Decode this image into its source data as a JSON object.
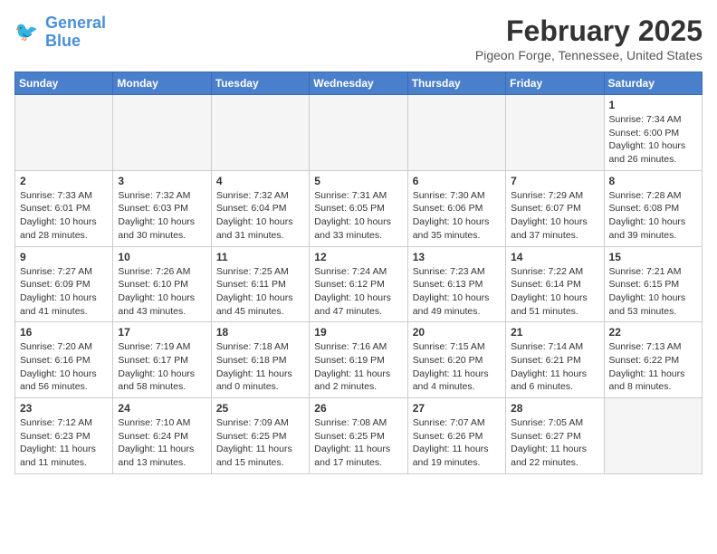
{
  "header": {
    "logo_line1": "General",
    "logo_line2": "Blue",
    "title": "February 2025",
    "subtitle": "Pigeon Forge, Tennessee, United States"
  },
  "weekdays": [
    "Sunday",
    "Monday",
    "Tuesday",
    "Wednesday",
    "Thursday",
    "Friday",
    "Saturday"
  ],
  "weeks": [
    [
      {
        "day": "",
        "info": ""
      },
      {
        "day": "",
        "info": ""
      },
      {
        "day": "",
        "info": ""
      },
      {
        "day": "",
        "info": ""
      },
      {
        "day": "",
        "info": ""
      },
      {
        "day": "",
        "info": ""
      },
      {
        "day": "1",
        "info": "Sunrise: 7:34 AM\nSunset: 6:00 PM\nDaylight: 10 hours and 26 minutes."
      }
    ],
    [
      {
        "day": "2",
        "info": "Sunrise: 7:33 AM\nSunset: 6:01 PM\nDaylight: 10 hours and 28 minutes."
      },
      {
        "day": "3",
        "info": "Sunrise: 7:32 AM\nSunset: 6:03 PM\nDaylight: 10 hours and 30 minutes."
      },
      {
        "day": "4",
        "info": "Sunrise: 7:32 AM\nSunset: 6:04 PM\nDaylight: 10 hours and 31 minutes."
      },
      {
        "day": "5",
        "info": "Sunrise: 7:31 AM\nSunset: 6:05 PM\nDaylight: 10 hours and 33 minutes."
      },
      {
        "day": "6",
        "info": "Sunrise: 7:30 AM\nSunset: 6:06 PM\nDaylight: 10 hours and 35 minutes."
      },
      {
        "day": "7",
        "info": "Sunrise: 7:29 AM\nSunset: 6:07 PM\nDaylight: 10 hours and 37 minutes."
      },
      {
        "day": "8",
        "info": "Sunrise: 7:28 AM\nSunset: 6:08 PM\nDaylight: 10 hours and 39 minutes."
      }
    ],
    [
      {
        "day": "9",
        "info": "Sunrise: 7:27 AM\nSunset: 6:09 PM\nDaylight: 10 hours and 41 minutes."
      },
      {
        "day": "10",
        "info": "Sunrise: 7:26 AM\nSunset: 6:10 PM\nDaylight: 10 hours and 43 minutes."
      },
      {
        "day": "11",
        "info": "Sunrise: 7:25 AM\nSunset: 6:11 PM\nDaylight: 10 hours and 45 minutes."
      },
      {
        "day": "12",
        "info": "Sunrise: 7:24 AM\nSunset: 6:12 PM\nDaylight: 10 hours and 47 minutes."
      },
      {
        "day": "13",
        "info": "Sunrise: 7:23 AM\nSunset: 6:13 PM\nDaylight: 10 hours and 49 minutes."
      },
      {
        "day": "14",
        "info": "Sunrise: 7:22 AM\nSunset: 6:14 PM\nDaylight: 10 hours and 51 minutes."
      },
      {
        "day": "15",
        "info": "Sunrise: 7:21 AM\nSunset: 6:15 PM\nDaylight: 10 hours and 53 minutes."
      }
    ],
    [
      {
        "day": "16",
        "info": "Sunrise: 7:20 AM\nSunset: 6:16 PM\nDaylight: 10 hours and 56 minutes."
      },
      {
        "day": "17",
        "info": "Sunrise: 7:19 AM\nSunset: 6:17 PM\nDaylight: 10 hours and 58 minutes."
      },
      {
        "day": "18",
        "info": "Sunrise: 7:18 AM\nSunset: 6:18 PM\nDaylight: 11 hours and 0 minutes."
      },
      {
        "day": "19",
        "info": "Sunrise: 7:16 AM\nSunset: 6:19 PM\nDaylight: 11 hours and 2 minutes."
      },
      {
        "day": "20",
        "info": "Sunrise: 7:15 AM\nSunset: 6:20 PM\nDaylight: 11 hours and 4 minutes."
      },
      {
        "day": "21",
        "info": "Sunrise: 7:14 AM\nSunset: 6:21 PM\nDaylight: 11 hours and 6 minutes."
      },
      {
        "day": "22",
        "info": "Sunrise: 7:13 AM\nSunset: 6:22 PM\nDaylight: 11 hours and 8 minutes."
      }
    ],
    [
      {
        "day": "23",
        "info": "Sunrise: 7:12 AM\nSunset: 6:23 PM\nDaylight: 11 hours and 11 minutes."
      },
      {
        "day": "24",
        "info": "Sunrise: 7:10 AM\nSunset: 6:24 PM\nDaylight: 11 hours and 13 minutes."
      },
      {
        "day": "25",
        "info": "Sunrise: 7:09 AM\nSunset: 6:25 PM\nDaylight: 11 hours and 15 minutes."
      },
      {
        "day": "26",
        "info": "Sunrise: 7:08 AM\nSunset: 6:25 PM\nDaylight: 11 hours and 17 minutes."
      },
      {
        "day": "27",
        "info": "Sunrise: 7:07 AM\nSunset: 6:26 PM\nDaylight: 11 hours and 19 minutes."
      },
      {
        "day": "28",
        "info": "Sunrise: 7:05 AM\nSunset: 6:27 PM\nDaylight: 11 hours and 22 minutes."
      },
      {
        "day": "",
        "info": ""
      }
    ]
  ]
}
